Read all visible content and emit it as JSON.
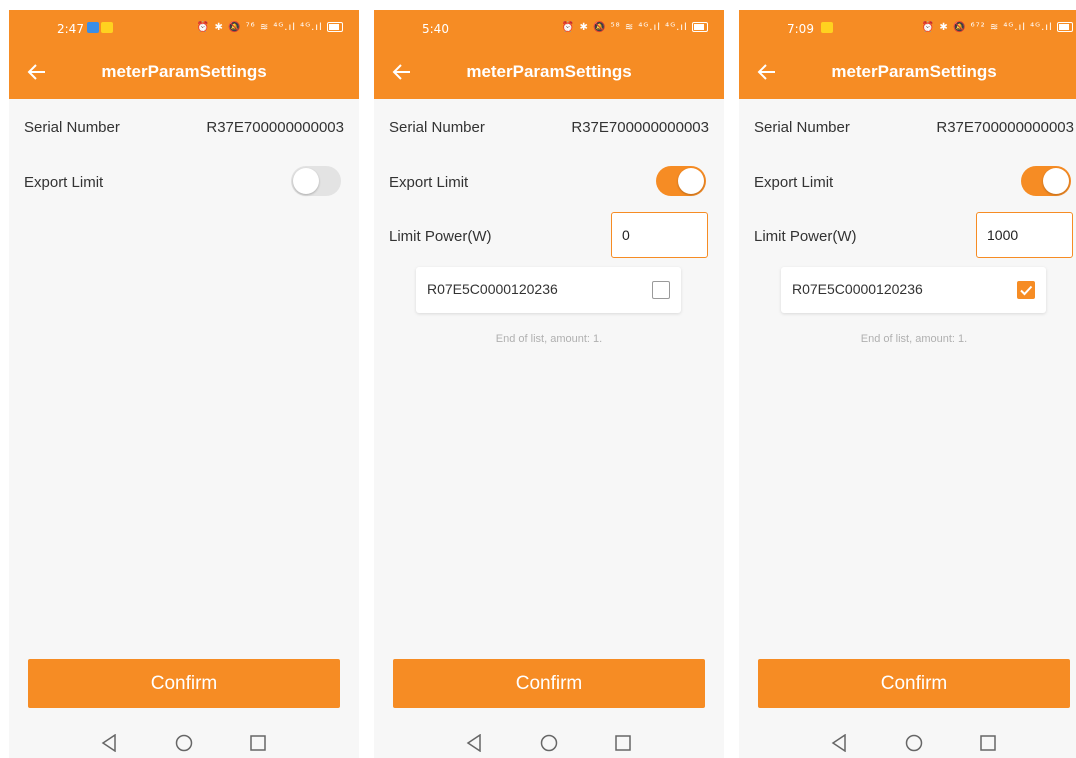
{
  "colors": {
    "accent": "#f68c24",
    "background": "#f7f7f7"
  },
  "screens": [
    {
      "status_time": "2:47",
      "status_icons": "⏰ ✱ 🔕 ⁷⁶ ≋ ⁴ᴳ.ıl ⁴ᴳ.ıl",
      "title": "meterParamSettings",
      "serial_label": "Serial Number",
      "serial_value": "R37E700000000003",
      "export_limit_label": "Export Limit",
      "export_limit_on": false,
      "confirm_label": "Confirm"
    },
    {
      "status_time": "5:40",
      "status_icons": "⏰ ✱ 🔕 ⁵⁸ ≋ ⁴ᴳ.ıl ⁴ᴳ.ıl",
      "title": "meterParamSettings",
      "serial_label": "Serial Number",
      "serial_value": "R37E700000000003",
      "export_limit_label": "Export Limit",
      "export_limit_on": true,
      "limit_power_label": "Limit Power(W)",
      "limit_power_value": "0",
      "device_id": "R07E5C0000120236",
      "device_checked": false,
      "list_footer": "End of list, amount: 1.",
      "confirm_label": "Confirm"
    },
    {
      "status_time": "7:09",
      "status_icons": "⏰ ✱ 🔕 ⁶⁷² ≋ ⁴ᴳ.ıl ⁴ᴳ.ıl",
      "title": "meterParamSettings",
      "serial_label": "Serial Number",
      "serial_value": "R37E700000000003",
      "export_limit_label": "Export Limit",
      "export_limit_on": true,
      "limit_power_label": "Limit Power(W)",
      "limit_power_value": "1000",
      "device_id": "R07E5C0000120236",
      "device_checked": true,
      "list_footer": "End of list, amount: 1.",
      "confirm_label": "Confirm"
    }
  ]
}
